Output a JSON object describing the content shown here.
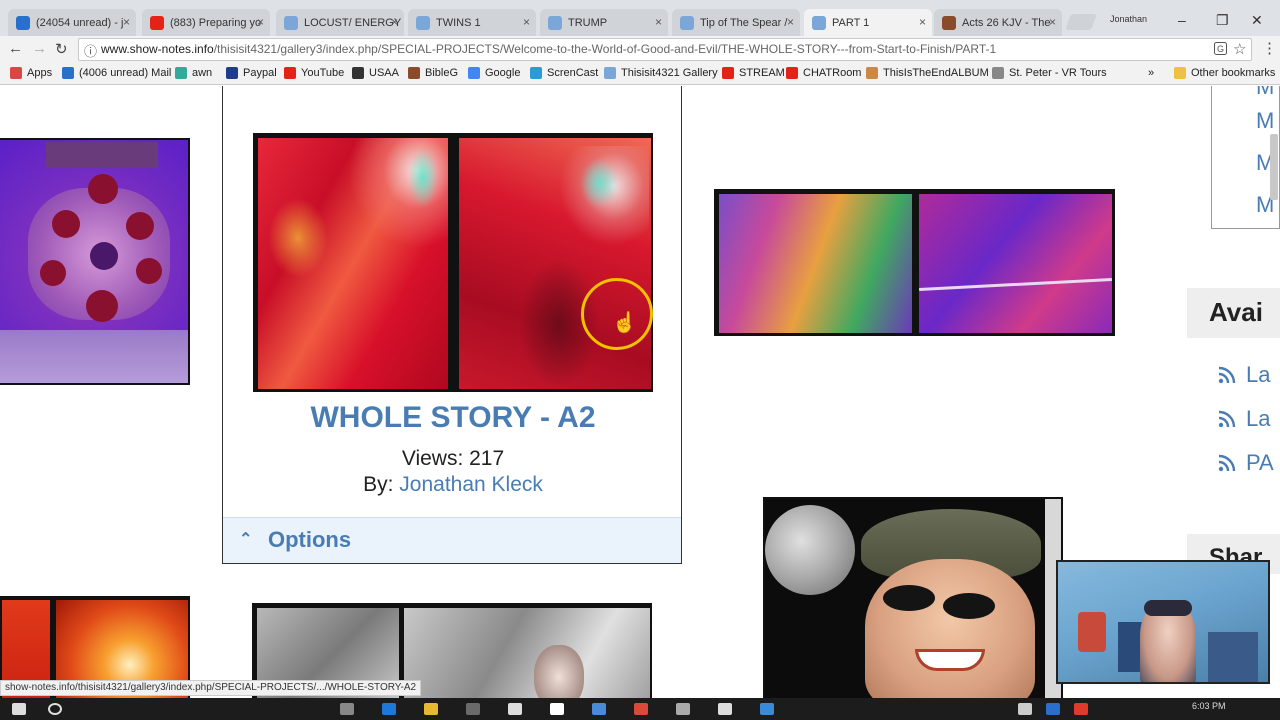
{
  "tabs": [
    {
      "label": "(24054 unread) - j",
      "fav": "#2a6fcb"
    },
    {
      "label": "(883) Preparing yo",
      "fav": "#e62117"
    },
    {
      "label": "LOCUST/ ENERGY",
      "fav": "#7aa7d8"
    },
    {
      "label": "TWINS 1",
      "fav": "#7aa7d8"
    },
    {
      "label": "TRUMP",
      "fav": "#7aa7d8"
    },
    {
      "label": "Tip of The Spear /",
      "fav": "#7aa7d8"
    },
    {
      "label": "PART 1",
      "fav": "#7aa7d8"
    },
    {
      "label": "Acts 26 KJV - The",
      "fav": "#8a4b2a"
    }
  ],
  "tab_close": "×",
  "profile_name": "Jonathan",
  "window_controls": {
    "minimize": "–",
    "maximize": "❐",
    "close": "✕"
  },
  "nav": {
    "back": "←",
    "forward": "→",
    "reload": "↻"
  },
  "address": {
    "info_icon": "ⓘ",
    "host": "www.show-notes.info",
    "path": "/thisisit4321/gallery3/index.php/SPECIAL-PROJECTS/Welcome-to-the-World-of-Good-and-Evil/THE-WHOLE-STORY---from-Start-to-Finish/PART-1",
    "star": "☆",
    "menu": "⋮"
  },
  "bookmarks": [
    {
      "label": "Apps",
      "color": "#d44"
    },
    {
      "label": "(4006 unread) Mail",
      "color": "#2a6fcb"
    },
    {
      "label": "awn",
      "color": "#3a9"
    },
    {
      "label": "Paypal",
      "color": "#1f3b8b"
    },
    {
      "label": "YouTube",
      "color": "#e62117"
    },
    {
      "label": "USAA",
      "color": "#333"
    },
    {
      "label": "BibleG",
      "color": "#8a4b2a"
    },
    {
      "label": "Google",
      "color": "#4285f4"
    },
    {
      "label": "ScrenCast",
      "color": "#2a9bd8"
    },
    {
      "label": "Thisisit4321 Gallery",
      "color": "#7aa7d8"
    },
    {
      "label": "STREAM",
      "color": "#e62117"
    },
    {
      "label": "CHATRoom",
      "color": "#e62117"
    },
    {
      "label": "ThisIsTheEndALBUM",
      "color": "#c84"
    },
    {
      "label": "St. Peter - VR Tours",
      "color": "#888"
    }
  ],
  "bookmarks_overflow": "»",
  "other_bookmarks": "Other bookmarks",
  "gallery": {
    "item_title": "WHOLE STORY - A2",
    "views": "Views: 217",
    "by_label": "By: ",
    "author": "Jonathan Kleck",
    "options_label": "Options",
    "options_chevron": "⌃"
  },
  "sidebar": {
    "letters": [
      "M",
      "M",
      "M",
      "M"
    ],
    "available_heading": "Avai",
    "feeds": [
      "La",
      "La",
      "PA"
    ],
    "share_heading": "Shar"
  },
  "status_url": "show-notes.info/thisisit4321/gallery3/index.php/SPECIAL-PROJECTS/.../WHOLE-STORY-A2",
  "clock": "6:03 PM"
}
